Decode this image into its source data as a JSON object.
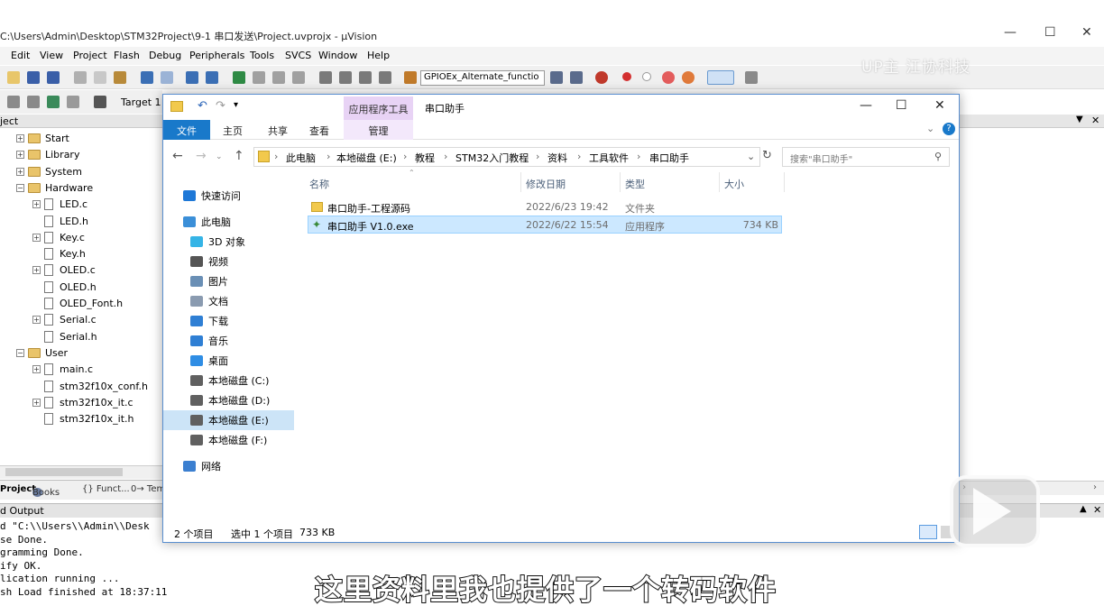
{
  "uvision": {
    "title": "C:\\Users\\Admin\\Desktop\\STM32Project\\9-1 串口发送\\Project.uvprojx - µVision",
    "menu": [
      "Edit",
      "View",
      "Project",
      "Flash",
      "Debug",
      "Peripherals",
      "Tools",
      "SVCS",
      "Window",
      "Help"
    ],
    "combo_value": "GPIOEx_Alternate_functio",
    "target": "Target 1",
    "project_panel_title": "ject",
    "tree": [
      {
        "label": "Start",
        "kind": "folder",
        "level": 1
      },
      {
        "label": "Library",
        "kind": "folder",
        "level": 1
      },
      {
        "label": "System",
        "kind": "folder",
        "level": 1
      },
      {
        "label": "Hardware",
        "kind": "folder",
        "level": 1
      },
      {
        "label": "LED.c",
        "kind": "file",
        "level": 2,
        "expand": true
      },
      {
        "label": "LED.h",
        "kind": "file",
        "level": 2
      },
      {
        "label": "Key.c",
        "kind": "file",
        "level": 2,
        "expand": true
      },
      {
        "label": "Key.h",
        "kind": "file",
        "level": 2
      },
      {
        "label": "OLED.c",
        "kind": "file",
        "level": 2,
        "expand": true
      },
      {
        "label": "OLED.h",
        "kind": "file",
        "level": 2
      },
      {
        "label": "OLED_Font.h",
        "kind": "file",
        "level": 2
      },
      {
        "label": "Serial.c",
        "kind": "file",
        "level": 2,
        "expand": true
      },
      {
        "label": "Serial.h",
        "kind": "file",
        "level": 2
      },
      {
        "label": "User",
        "kind": "folder",
        "level": 1
      },
      {
        "label": "main.c",
        "kind": "file",
        "level": 2,
        "expand": true
      },
      {
        "label": "stm32f10x_conf.h",
        "kind": "file",
        "level": 2
      },
      {
        "label": "stm32f10x_it.c",
        "kind": "file",
        "level": 2,
        "expand": true
      },
      {
        "label": "stm32f10x_it.h",
        "kind": "file",
        "level": 2
      }
    ],
    "panel_tabs": [
      "Project",
      "Books",
      "{} Funct...",
      "0→ Tem"
    ],
    "output_title": "d Output",
    "output_lines": [
      "d \"C:\\\\Users\\\\Admin\\\\Desk",
      "se Done.",
      "gramming Done.",
      "ify OK.",
      "lication running ...",
      "sh Load finished at 18:37:11"
    ]
  },
  "explorer": {
    "context_tab": "应用程序工具",
    "window_title": "串口助手",
    "ribbon_tabs": [
      "文件",
      "主页",
      "共享",
      "查看",
      "管理"
    ],
    "breadcrumbs": [
      "此电脑",
      "本地磁盘 (E:)",
      "教程",
      "STM32入门教程",
      "资料",
      "工具软件",
      "串口助手"
    ],
    "search_placeholder": "搜索\"串口助手\"",
    "nav": [
      {
        "label": "快速访问",
        "icon": "star-icon",
        "color": "#1e78d7"
      },
      {
        "label": "此电脑",
        "icon": "computer-icon",
        "color": "#3b8fd8"
      },
      {
        "label": "3D 对象",
        "icon": "cube-icon",
        "color": "#35b4e6"
      },
      {
        "label": "视频",
        "icon": "video-icon",
        "color": "#555555"
      },
      {
        "label": "图片",
        "icon": "picture-icon",
        "color": "#6a8fb5"
      },
      {
        "label": "文档",
        "icon": "document-icon",
        "color": "#8a9bb0"
      },
      {
        "label": "下载",
        "icon": "download-icon",
        "color": "#2f7fd4"
      },
      {
        "label": "音乐",
        "icon": "music-icon",
        "color": "#2f7fd4"
      },
      {
        "label": "桌面",
        "icon": "desktop-icon",
        "color": "#2f8de4"
      },
      {
        "label": "本地磁盘 (C:)",
        "icon": "drive-c-icon",
        "color": "#606060"
      },
      {
        "label": "本地磁盘 (D:)",
        "icon": "drive-d-icon",
        "color": "#606060"
      },
      {
        "label": "本地磁盘 (E:)",
        "icon": "drive-e-icon",
        "color": "#606060",
        "selected": true
      },
      {
        "label": "本地磁盘 (F:)",
        "icon": "drive-f-icon",
        "color": "#606060"
      },
      {
        "label": "网络",
        "icon": "network-icon",
        "color": "#3b7fd0"
      }
    ],
    "columns": [
      "名称",
      "修改日期",
      "类型",
      "大小"
    ],
    "rows": [
      {
        "name": "串口助手-工程源码",
        "date": "2022/6/23 19:42",
        "type": "文件夹",
        "size": "",
        "icon": "folder-icon"
      },
      {
        "name": "串口助手 V1.0.exe",
        "date": "2022/6/22 15:54",
        "type": "应用程序",
        "size": "734 KB",
        "icon": "app-icon",
        "selected": true
      }
    ],
    "status_count": "2 个项目",
    "status_selected": "选中 1 个项目",
    "status_size": "733 KB"
  },
  "subtitle": "这里资料里我也提供了一个转码软件",
  "watermark": "UP主 江协科技",
  "colors": {
    "accent": "#1979ca",
    "selection": "#cce8ff",
    "context_tab": "#e8d3f5"
  }
}
